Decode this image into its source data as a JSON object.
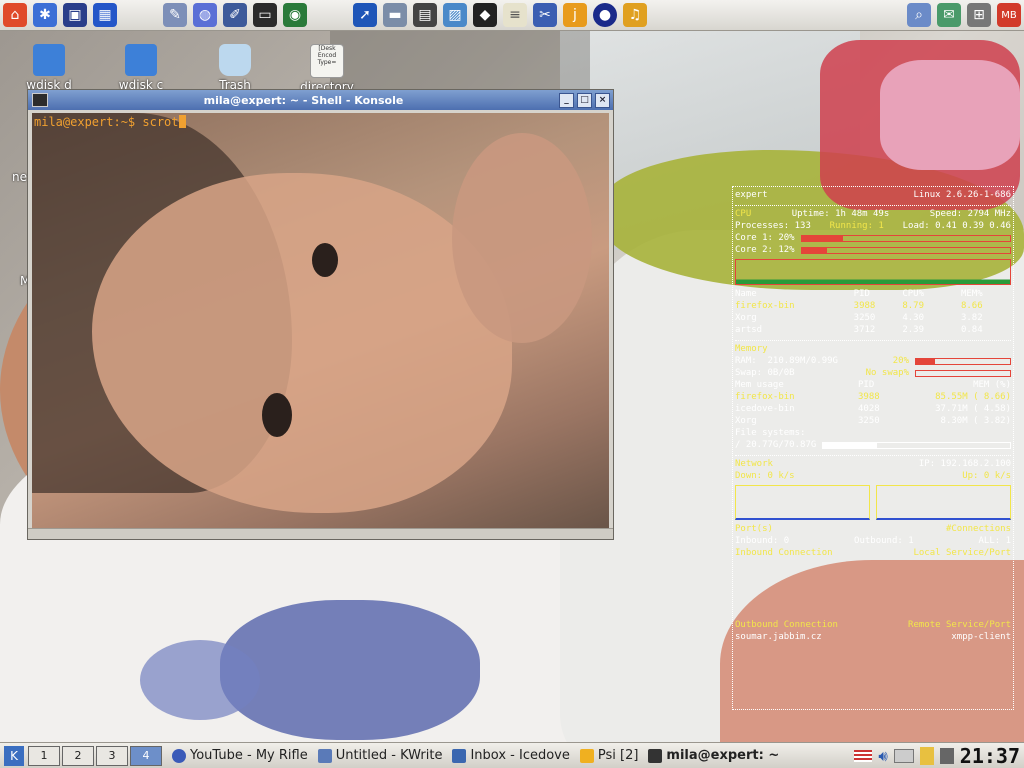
{
  "desktop": {
    "icons": [
      {
        "label": "wdisk d"
      },
      {
        "label": "wdisk c"
      },
      {
        "label": "Trash"
      },
      {
        "label": "directory",
        "thumb_text": "[Desk Encod Type="
      }
    ],
    "side_fragments": [
      "ne",
      "M"
    ]
  },
  "top_panel": {
    "launchers": [
      "home-icon",
      "settings-icon",
      "window-icon",
      "tiles-icon",
      "web-icon",
      "globe-icon",
      "edit-icon",
      "monitor-icon",
      "earth-icon",
      "compass-icon",
      "bus-icon",
      "film-icon",
      "photo-icon",
      "ink-icon",
      "notes-icon",
      "tools-icon",
      "je-icon",
      "sphere-icon",
      "headphones-icon"
    ],
    "right_icons": [
      "magnifier-icon",
      "paper-icon",
      "network-icon",
      "mb-icon"
    ]
  },
  "konsole": {
    "title": "mila@expert: ~ - Shell - Konsole",
    "prompt": "mila@expert:~$ ",
    "command": "scrot",
    "buttons": {
      "minimize": "_",
      "maximize": "□",
      "close": "×"
    }
  },
  "conky": {
    "host": "expert",
    "kernel": "Linux 2.6.26-1-686",
    "cpu_label": "CPU",
    "uptime": "Uptime: 1h 48m 49s",
    "speed": "Speed: 2794 MHz",
    "processes": "Processes: 133",
    "running": "Running: 1",
    "load": "Load: 0.41 0.39 0.46",
    "core1": "Core 1: 20%",
    "core1_pct": 20,
    "core2": "Core 2: 12%",
    "core2_pct": 12,
    "proc_headers": [
      "Name",
      "PID",
      "CPU%",
      "MEM%"
    ],
    "procs": [
      {
        "name": "firefox-bin",
        "pid": "3988",
        "cpu": "8.79",
        "mem": "8.66"
      },
      {
        "name": "Xorg",
        "pid": "3250",
        "cpu": "4.30",
        "mem": "3.82"
      },
      {
        "name": "artsd",
        "pid": "3712",
        "cpu": "2.39",
        "mem": "0.84"
      }
    ],
    "memory_label": "Memory",
    "ram": "RAM:  210.89M/0.99G",
    "ram_pct_text": "20%",
    "ram_pct": 20,
    "swap": "Swap: 0B/0B",
    "swap_text": "No swap%",
    "mem_headers": [
      "Mem usage",
      "PID",
      "MEM (%)"
    ],
    "mem_procs": [
      {
        "name": "firefox-bin",
        "pid": "3988",
        "mem": "85.55M ( 8.66)"
      },
      {
        "name": "icedove-bin",
        "pid": "4028",
        "mem": "37.71M ( 4.58)"
      },
      {
        "name": "Xorg",
        "pid": "3250",
        "mem": "8.30M ( 3.82)"
      }
    ],
    "fs_label": "File systems:",
    "fs": "/ 20.77G/70.87G",
    "fs_pct": 29,
    "network_label": "Network",
    "ip": "IP: 192.168.2.100",
    "down": "Down: 0 k/s",
    "up": "Up: 0 k/s",
    "ports_label": "Port(s)",
    "connections_label": "#Connections",
    "inbound": "Inbound: 0",
    "outbound": "Outbound: 1",
    "all": "ALL: 1",
    "in_conn": "Inbound Connection",
    "local_sp": "Local Service/Port",
    "out_conn": "Outbound Connection",
    "remote_sp": "Remote Service/Port",
    "remote_host": "soumar.jabbim.cz",
    "remote_service": "xmpp-client"
  },
  "taskbar": {
    "pager": [
      "1",
      "2",
      "3",
      "4"
    ],
    "tasks": [
      {
        "label": "YouTube - My Rifle"
      },
      {
        "label": "Untitled - KWrite"
      },
      {
        "label": "Inbox - Icedove"
      },
      {
        "label": "Psi [2]"
      },
      {
        "label": "mila@expert: ~"
      }
    ],
    "clock": "21:37"
  }
}
